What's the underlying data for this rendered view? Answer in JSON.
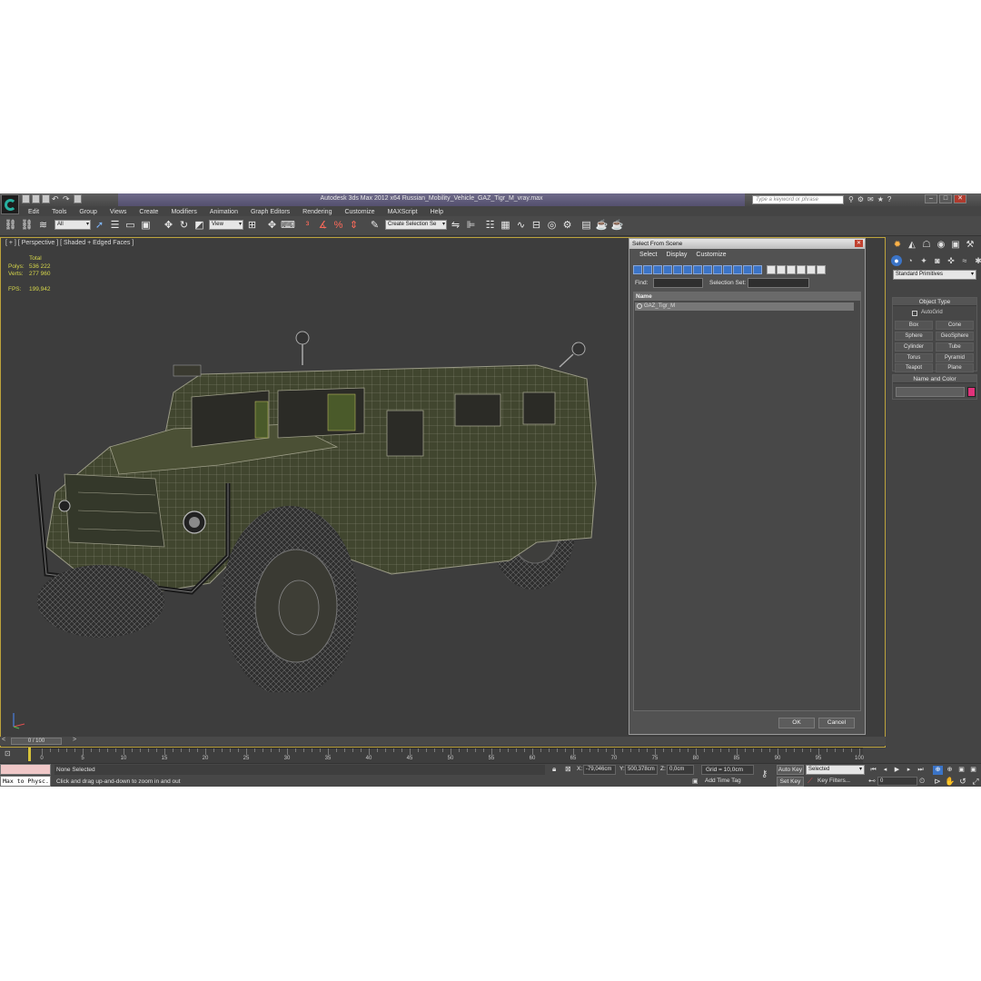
{
  "window": {
    "title": "Autodesk 3ds Max  2012 x64     Russian_Mobility_Vehicle_GAZ_Tigr_M_vray.max",
    "search_placeholder": "Type a keyword or phrase"
  },
  "menu": [
    "Edit",
    "Tools",
    "Group",
    "Views",
    "Create",
    "Modifiers",
    "Animation",
    "Graph Editors",
    "Rendering",
    "Customize",
    "MAXScript",
    "Help"
  ],
  "toolbar": {
    "filter_value": "All",
    "ref_coord_value": "View",
    "named_selection_placeholder": "Create Selection Se"
  },
  "viewport": {
    "label": "[ + ] [ Perspective ] [ Shaded + Edged Faces ]",
    "stats": {
      "header": "Total",
      "polys_label": "Polys:",
      "polys_value": "536 222",
      "verts_label": "Verts:",
      "verts_value": "277 960",
      "fps_label": "FPS:",
      "fps_value": "199,942"
    }
  },
  "dialog": {
    "title": "Select From Scene",
    "menu": [
      "Select",
      "Display",
      "Customize"
    ],
    "find_label": "Find:",
    "selection_set_label": "Selection Set:",
    "column_name": "Name",
    "objects": [
      "GAZ_Tigr_M"
    ],
    "ok_label": "OK",
    "cancel_label": "Cancel"
  },
  "command_panel": {
    "category": "Standard Primitives",
    "object_type_title": "Object Type",
    "autogrid_label": "AutoGrid",
    "primitives": [
      "Box",
      "Cone",
      "Sphere",
      "GeoSphere",
      "Cylinder",
      "Tube",
      "Torus",
      "Pyramid",
      "Teapot",
      "Plane"
    ],
    "name_color_title": "Name and Color",
    "object_color": "#e0327a"
  },
  "timeline": {
    "slider_label": "0 / 100",
    "ticks": [
      "0",
      "5",
      "10",
      "15",
      "20",
      "25",
      "30",
      "35",
      "40",
      "45",
      "50",
      "55",
      "60",
      "65",
      "70",
      "75",
      "80",
      "85",
      "90",
      "95",
      "100"
    ]
  },
  "status": {
    "maxscript_text": "Max to Physc.",
    "selection": "None Selected",
    "prompt": "Click and drag up-and-down to zoom in and out",
    "x_label": "X:",
    "x_value": "-79,046cm",
    "y_label": "Y:",
    "y_value": "500,378cm",
    "z_label": "Z:",
    "z_value": "0,0cm",
    "grid": "Grid = 10,0cm",
    "add_time_tag": "Add Time Tag",
    "auto_key": "Auto Key",
    "set_key": "Set Key",
    "selected_value": "Selected",
    "key_filters": "Key Filters...",
    "frame_value": "0"
  }
}
